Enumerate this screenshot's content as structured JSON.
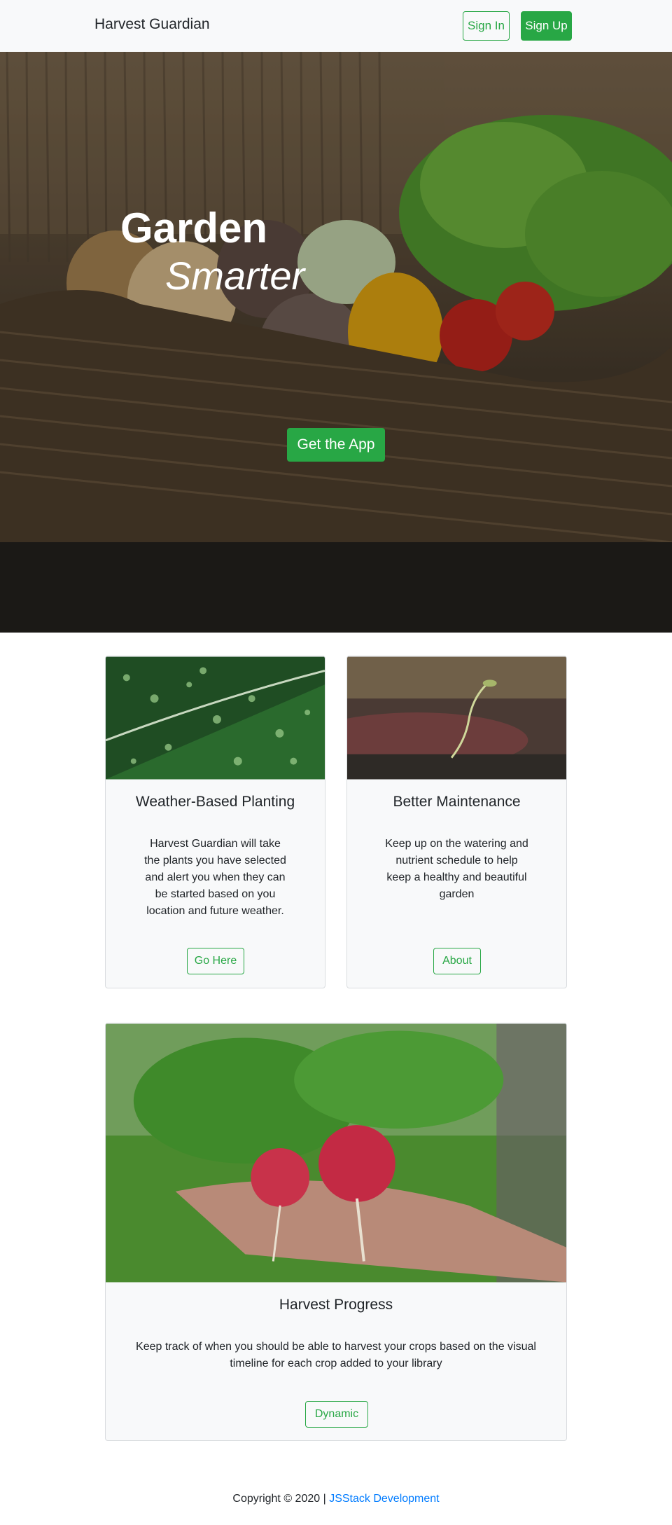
{
  "navbar": {
    "brand": "Harvest Guardian",
    "sign_in_label": "Sign In",
    "sign_up_label": "Sign Up"
  },
  "hero": {
    "title_line1": "Garden",
    "title_line2": "Smarter",
    "cta_label": "Get the App",
    "image": "vegetable-basket-photo"
  },
  "cards": [
    {
      "image": "leaf-with-water-droplets-photo",
      "title": "Weather-Based Planting",
      "text": "Harvest Guardian will take the plants you have selected and alert you when they can be started based on you location and future weather.",
      "button_label": "Go Here"
    },
    {
      "image": "seedling-sprout-photo",
      "title": "Better Maintenance",
      "text": "Keep up on the watering and nutrient schedule to help keep a healthy and beautiful garden",
      "button_label": "About"
    },
    {
      "image": "radishes-in-hand-photo",
      "title": "Harvest Progress",
      "text": "Keep track of when you should be able to harvest your crops based on the visual timeline for each crop added to your library",
      "button_label": "Dynamic"
    }
  ],
  "footer": {
    "copyright": "Copyright © 2020 |",
    "link_label": "JSStack Development"
  },
  "colors": {
    "accent": "#28a745",
    "link": "#007bff",
    "navbar_bg": "#f8f9fa"
  }
}
